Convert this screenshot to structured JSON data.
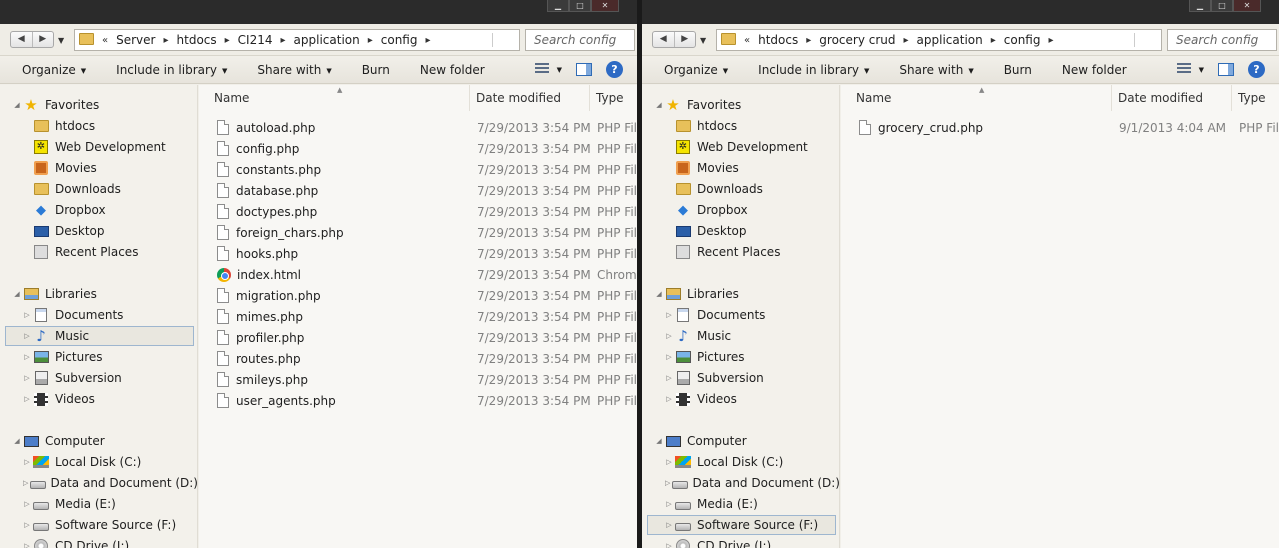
{
  "left": {
    "search_placeholder": "Search config",
    "breadcrumb": [
      "Server",
      "htdocs",
      "CI214",
      "application",
      "config"
    ],
    "files": [
      {
        "name": "autoload.php",
        "date": "7/29/2013 3:54 PM",
        "type": "PHP File",
        "icon": "php-file-icon"
      },
      {
        "name": "config.php",
        "date": "7/29/2013 3:54 PM",
        "type": "PHP File",
        "icon": "php-file-icon"
      },
      {
        "name": "constants.php",
        "date": "7/29/2013 3:54 PM",
        "type": "PHP File",
        "icon": "php-file-icon"
      },
      {
        "name": "database.php",
        "date": "7/29/2013 3:54 PM",
        "type": "PHP File",
        "icon": "php-file-icon"
      },
      {
        "name": "doctypes.php",
        "date": "7/29/2013 3:54 PM",
        "type": "PHP File",
        "icon": "php-file-icon"
      },
      {
        "name": "foreign_chars.php",
        "date": "7/29/2013 3:54 PM",
        "type": "PHP File",
        "icon": "php-file-icon"
      },
      {
        "name": "hooks.php",
        "date": "7/29/2013 3:54 PM",
        "type": "PHP File",
        "icon": "php-file-icon"
      },
      {
        "name": "index.html",
        "date": "7/29/2013 3:54 PM",
        "type": "Chrome HTML Document",
        "icon": "chrome-icon"
      },
      {
        "name": "migration.php",
        "date": "7/29/2013 3:54 PM",
        "type": "PHP File",
        "icon": "php-file-icon"
      },
      {
        "name": "mimes.php",
        "date": "7/29/2013 3:54 PM",
        "type": "PHP File",
        "icon": "php-file-icon"
      },
      {
        "name": "profiler.php",
        "date": "7/29/2013 3:54 PM",
        "type": "PHP File",
        "icon": "php-file-icon"
      },
      {
        "name": "routes.php",
        "date": "7/29/2013 3:54 PM",
        "type": "PHP File",
        "icon": "php-file-icon"
      },
      {
        "name": "smileys.php",
        "date": "7/29/2013 3:54 PM",
        "type": "PHP File",
        "icon": "php-file-icon"
      },
      {
        "name": "user_agents.php",
        "date": "7/29/2013 3:54 PM",
        "type": "PHP File",
        "icon": "php-file-icon"
      }
    ],
    "selected_nav": "Music"
  },
  "right": {
    "search_placeholder": "Search config",
    "breadcrumb": [
      "htdocs",
      "grocery crud",
      "application",
      "config"
    ],
    "files": [
      {
        "name": "grocery_crud.php",
        "date": "9/1/2013 4:04 AM",
        "type": "PHP File",
        "icon": "php-file-icon"
      }
    ],
    "selected_nav": "Software Source (F:)"
  },
  "breadcrumb_overflow": "«",
  "toolbar": {
    "organize": "Organize",
    "include_in_library": "Include in library",
    "share_with": "Share with",
    "burn": "Burn",
    "new_folder": "New folder"
  },
  "columns": {
    "name": "Name",
    "date": "Date modified",
    "type": "Type"
  },
  "nav": [
    {
      "label": "Favorites",
      "icon": "star-icon",
      "level": 0,
      "expander": "open"
    },
    {
      "label": "htdocs",
      "icon": "folder-icon",
      "level": 1
    },
    {
      "label": "Web Development",
      "icon": "web-development-icon",
      "level": 1
    },
    {
      "label": "Movies",
      "icon": "movies-icon",
      "level": 1
    },
    {
      "label": "Downloads",
      "icon": "folder-icon",
      "level": 1
    },
    {
      "label": "Dropbox",
      "icon": "dropbox-icon",
      "level": 1
    },
    {
      "label": "Desktop",
      "icon": "desktop-icon",
      "level": 1
    },
    {
      "label": "Recent Places",
      "icon": "recent-places-icon",
      "level": 1
    },
    {
      "label": "",
      "icon": "",
      "level": -1
    },
    {
      "label": "Libraries",
      "icon": "libraries-icon",
      "level": 0,
      "expander": "open"
    },
    {
      "label": "Documents",
      "icon": "documents-icon",
      "level": 1,
      "expander": "closed"
    },
    {
      "label": "Music",
      "icon": "music-icon",
      "level": 1,
      "expander": "closed"
    },
    {
      "label": "Pictures",
      "icon": "pictures-icon",
      "level": 1,
      "expander": "closed"
    },
    {
      "label": "Subversion",
      "icon": "subversion-icon",
      "level": 1,
      "expander": "closed"
    },
    {
      "label": "Videos",
      "icon": "videos-icon",
      "level": 1,
      "expander": "closed"
    },
    {
      "label": "",
      "icon": "",
      "level": -1
    },
    {
      "label": "Computer",
      "icon": "computer-icon",
      "level": 0,
      "expander": "open"
    },
    {
      "label": "Local Disk (C:)",
      "icon": "windows-disk-icon",
      "level": 1,
      "expander": "closed"
    },
    {
      "label": "Data and Document (D:)",
      "icon": "disk-icon",
      "level": 1,
      "expander": "closed"
    },
    {
      "label": "Media (E:)",
      "icon": "disk-icon",
      "level": 1,
      "expander": "closed"
    },
    {
      "label": "Software Source (F:)",
      "icon": "disk-icon",
      "level": 1,
      "expander": "closed"
    },
    {
      "label": "CD Drive (I:)",
      "icon": "cd-drive-icon",
      "level": 1,
      "expander": "closed"
    }
  ]
}
